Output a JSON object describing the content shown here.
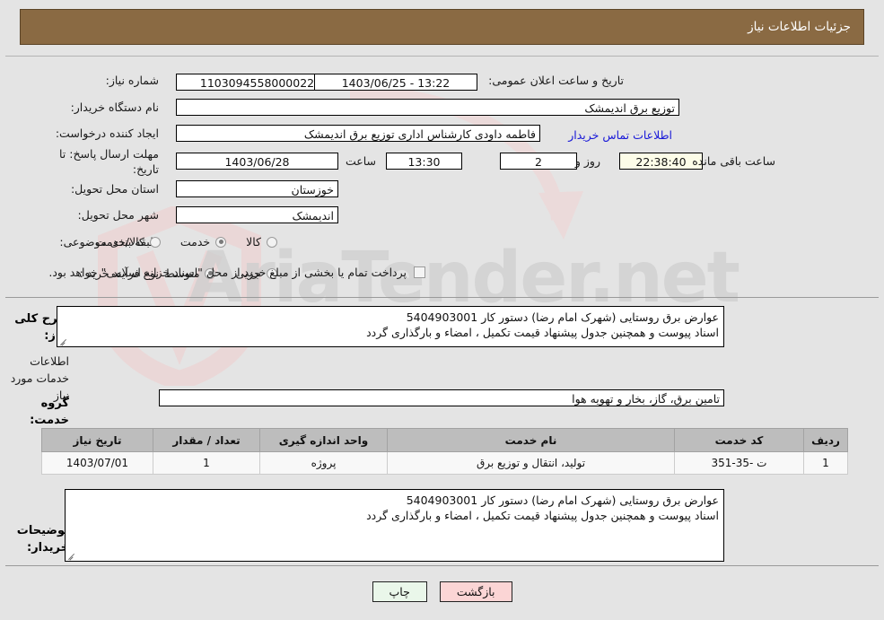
{
  "header": {
    "title": "جزئیات اطلاعات نیاز"
  },
  "watermark": {
    "text": "AriaTender.net"
  },
  "form": {
    "need_number_label": "شماره نیاز:",
    "need_number_value": "1103094558000022",
    "public_announce_label": "تاریخ و ساعت اعلان عمومی:",
    "public_announce_value": "13:22 - 1403/06/25",
    "buyer_org_label": "نام دستگاه خریدار:",
    "buyer_org_value": "توزیع برق اندیمشک",
    "creator_label": "ایجاد کننده درخواست:",
    "creator_value": "فاطمه داودی کارشناس اداری توزیع برق اندیمشک",
    "contact_link": "اطلاعات تماس خریدار",
    "deadline_label": "مهلت ارسال پاسخ: تا تاریخ:",
    "deadline_date": "1403/06/28",
    "deadline_hour_label": "ساعت",
    "deadline_time": "13:30",
    "days_value": "2",
    "days_label": "روز و",
    "countdown_value": "22:38:40",
    "countdown_label": "ساعت باقی مانده",
    "province_label": "استان محل تحویل:",
    "province_value": "خوزستان",
    "city_label": "شهر محل تحویل:",
    "city_value": "اندیمشک",
    "category_label": "طبقه بندی موضوعی:",
    "category_options": [
      {
        "label": "کالا",
        "selected": false
      },
      {
        "label": "خدمت",
        "selected": true
      },
      {
        "label": "کالا/خدمت",
        "selected": false
      }
    ],
    "process_label": "نوع فرآیند خرید :",
    "process_options": [
      {
        "label": "جزیی",
        "selected": false
      },
      {
        "label": "متوسط",
        "selected": true
      }
    ],
    "treasury_checkbox_label": "پرداخت تمام یا بخشی از مبلغ خرید،از محل \"اسناد خزانه اسلامی\" خواهد بود.",
    "treasury_checked": false
  },
  "description": {
    "label": "شرح کلی نیاز:",
    "line1": "عوارض برق روستایی (شهرک امام رضا)   دستور کار 5404903001",
    "line2": "اسناد پیوست و همچنین جدول پیشنهاد قیمت تکمیل ، امضاء  و بارگذاری گردد"
  },
  "services_section": {
    "title": "اطلاعات خدمات مورد نیاز",
    "group_label": "گروه خدمت:",
    "group_value": "تامین برق، گاز، بخار و تهویه هوا"
  },
  "table": {
    "headers": [
      "ردیف",
      "کد خدمت",
      "نام خدمت",
      "واحد اندازه گیری",
      "تعداد / مقدار",
      "تاریخ نیاز"
    ],
    "rows": [
      {
        "row_no": "1",
        "service_code": "ت -35-351",
        "service_name": "تولید، انتقال و توزیع برق",
        "unit": "پروژه",
        "quantity": "1",
        "need_date": "1403/07/01"
      }
    ]
  },
  "buyer_notes": {
    "label": "توضیحات خریدار:",
    "line1": "عوارض برق روستایی (شهرک امام رضا)   دستور کار 5404903001",
    "line2": "اسناد پیوست و همچنین جدول پیشنهاد قیمت تکمیل ، امضاء  و بارگذاری گردد"
  },
  "buttons": {
    "print": "چاپ",
    "back": "بازگشت"
  },
  "colors": {
    "header_bg": "#8a6a43",
    "link": "#1818d8",
    "timer_bg": "#fdfde8",
    "back_btn": "#fbd5d5",
    "print_btn": "#eaf7ea",
    "table_header_bg": "#bdbdbd"
  }
}
